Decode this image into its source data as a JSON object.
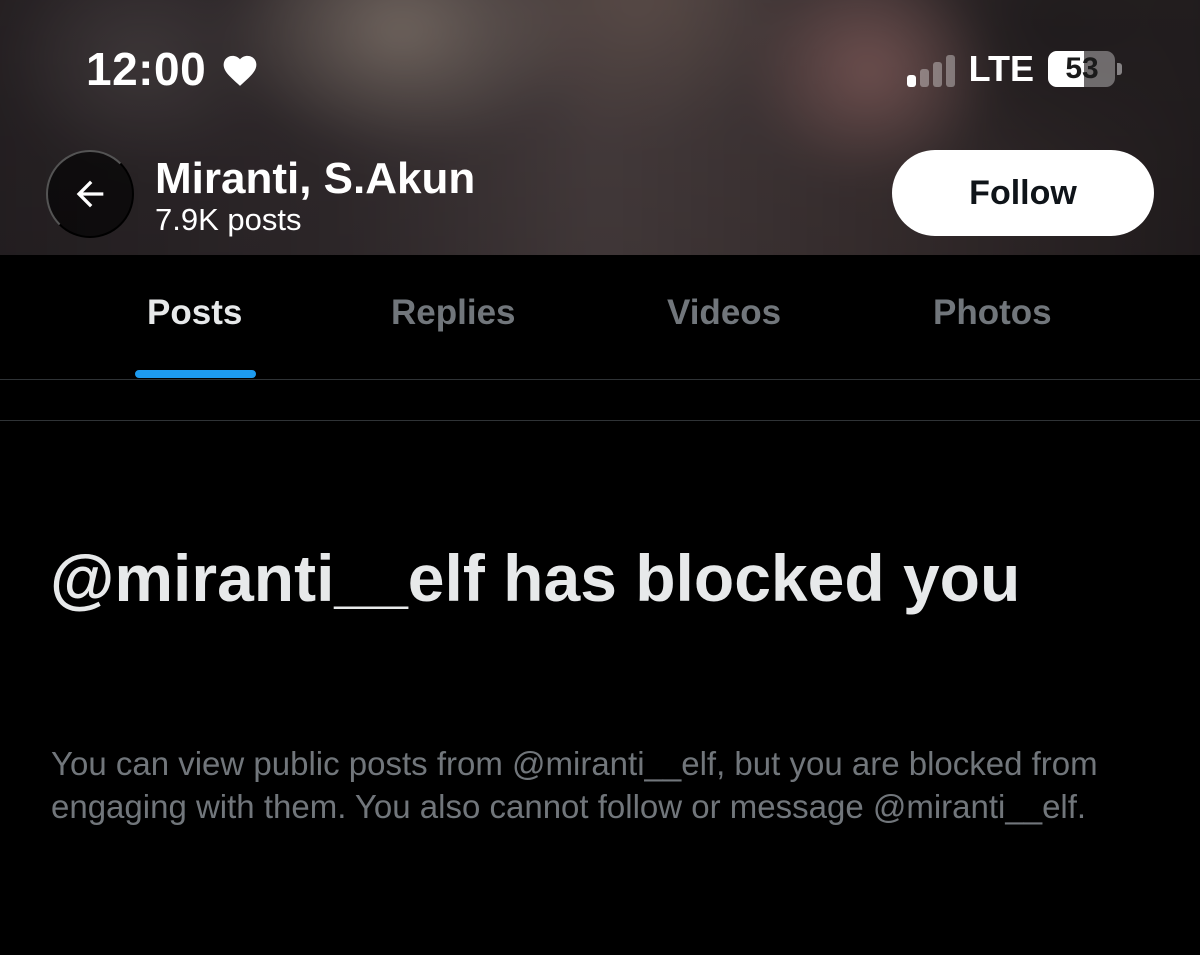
{
  "status_bar": {
    "time": "12:00",
    "network": "LTE",
    "battery_level": "53",
    "battery_fraction": 0.53,
    "signal_bars_active": 1,
    "signal_bars_total": 4
  },
  "header": {
    "name": "Miranti, S.Akun",
    "posts_count": "7.9K posts",
    "follow_label": "Follow"
  },
  "tabs": [
    {
      "label": "Posts",
      "active": true
    },
    {
      "label": "Replies",
      "active": false
    },
    {
      "label": "Videos",
      "active": false
    },
    {
      "label": "Photos",
      "active": false
    }
  ],
  "blocked": {
    "title": "@miranti__elf has blocked you",
    "body": "You can view public posts from @miranti__elf, but you are blocked from engaging with them. You also cannot follow or message @miranti__elf."
  },
  "colors": {
    "accent": "#1d9bf0",
    "primary_text": "#e7e9ea",
    "secondary_text": "#71767b",
    "background": "#000000"
  },
  "icons": [
    "heart-icon",
    "signal-icon",
    "battery-icon",
    "back-arrow-icon"
  ]
}
